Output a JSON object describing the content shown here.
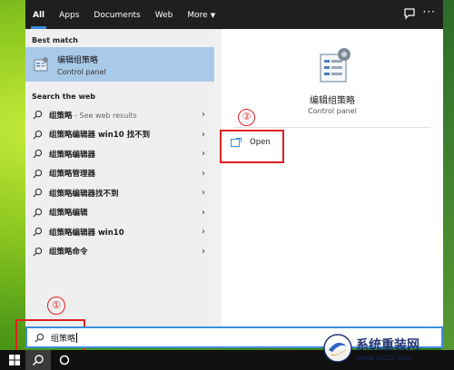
{
  "tabs": [
    {
      "label": "All",
      "active": true
    },
    {
      "label": "Apps"
    },
    {
      "label": "Documents"
    },
    {
      "label": "Web"
    },
    {
      "label": "More"
    }
  ],
  "best_match": {
    "header": "Best match",
    "title": "编辑组策略",
    "subtitle": "Control panel"
  },
  "web": {
    "header": "Search the web",
    "items": [
      {
        "bold": "组策略",
        "suffix": " - See web results"
      },
      {
        "bold": "组策略编辑器 win10 找不到",
        "suffix": ""
      },
      {
        "bold": "组策略编辑器",
        "suffix": ""
      },
      {
        "bold": "组策略管理器",
        "suffix": ""
      },
      {
        "bold": "组策略编辑器找不到",
        "suffix": ""
      },
      {
        "bold": "组策略编辑",
        "suffix": ""
      },
      {
        "bold": "组策略编辑器 win10",
        "suffix": ""
      },
      {
        "bold": "组策略命令",
        "suffix": ""
      }
    ]
  },
  "detail": {
    "title": "编辑组策略",
    "subtitle": "Control panel",
    "open_label": "Open"
  },
  "annotations": {
    "one": "①",
    "two": "②"
  },
  "search": {
    "value": "组策略"
  },
  "watermark": {
    "title": "系统重装网",
    "url": "www.xtcz2.com"
  },
  "colors": {
    "accent": "#3b8edb",
    "highlight": "#a9c9e9",
    "annotation": "#e02020"
  }
}
